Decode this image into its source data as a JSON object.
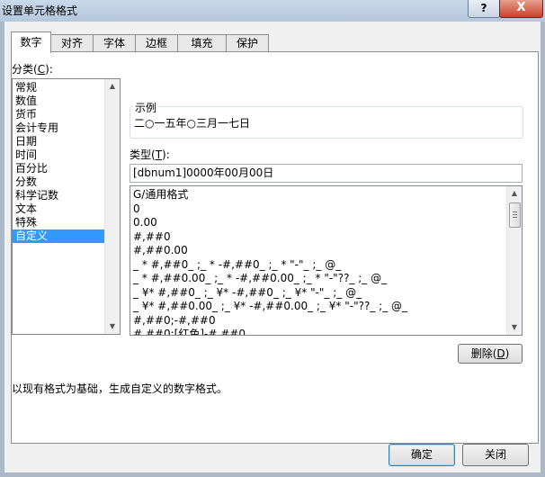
{
  "window": {
    "title": "设置单元格格式",
    "help_label": "?",
    "close_label": "X"
  },
  "tabs": [
    "数字",
    "对齐",
    "字体",
    "边框",
    "填充",
    "保护"
  ],
  "category": {
    "label": "分类(C):",
    "label_pre": "分类(",
    "label_key": "C",
    "label_post": "):",
    "items": [
      "常规",
      "数值",
      "货币",
      "会计专用",
      "日期",
      "时间",
      "百分比",
      "分数",
      "科学记数",
      "文本",
      "特殊",
      "自定义"
    ],
    "selected": "自定义"
  },
  "sample": {
    "label": "示例",
    "value": "二○一五年○三月一七日"
  },
  "type": {
    "label": "类型(T):",
    "label_pre": "类型(",
    "label_key": "T",
    "label_post": "):",
    "value": "[dbnum1]0000年00月00日"
  },
  "formats": [
    "G/通用格式",
    "0",
    "0.00",
    "#,##0",
    "#,##0.00",
    "_ * #,##0_ ;_ * -#,##0_ ;_ * \"-\"_ ;_ @_",
    "_ * #,##0.00_ ;_ * -#,##0.00_ ;_ * \"-\"??_ ;_ @_",
    "_ ¥* #,##0_ ;_ ¥* -#,##0_ ;_ ¥* \"-\"_ ;_ @_",
    "_ ¥* #,##0.00_ ;_ ¥* -#,##0.00_ ;_ ¥* \"-\"??_ ;_ @_",
    "#,##0;-#,##0",
    "#,##0;[红色]-#,##0"
  ],
  "delete_button": {
    "label": "删除(D)",
    "pre": "删除(",
    "key": "D",
    "post": ")"
  },
  "description": "以现有格式为基础，生成自定义的数字格式。",
  "footer": {
    "ok": "确定",
    "cancel": "关闭"
  }
}
